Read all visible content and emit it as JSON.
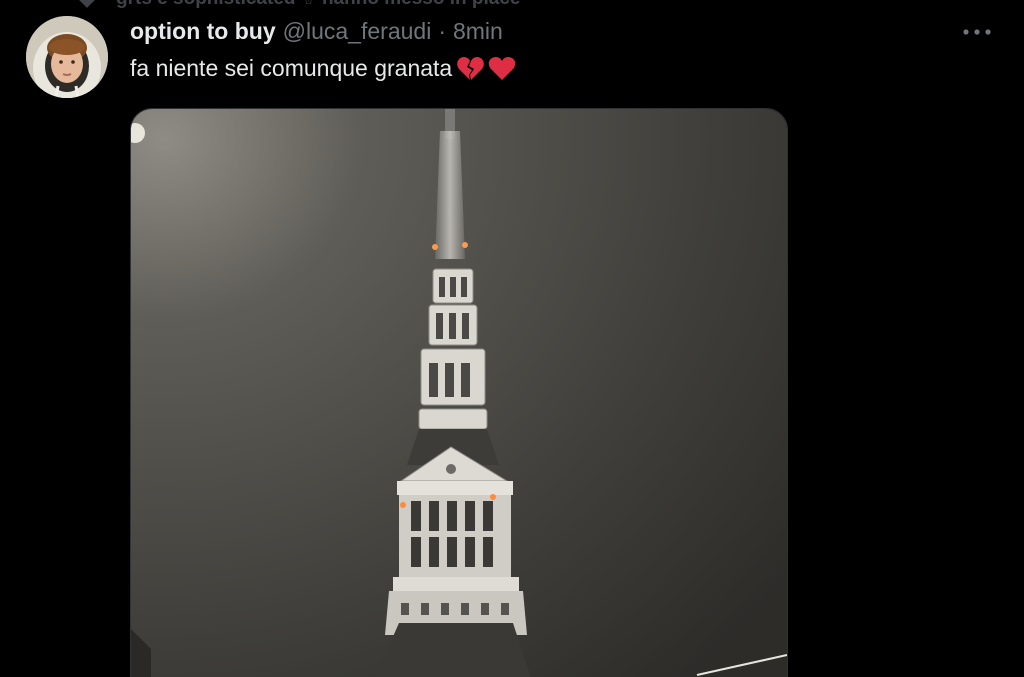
{
  "previous_tweet": {
    "partial_text": "grts e sophisticated ✌ hanno messo in place"
  },
  "author": {
    "display_name": "option to buy",
    "handle": "@luca_feraudi",
    "separator": "·",
    "timestamp": "8min"
  },
  "tweet": {
    "text": "fa niente sei comunque granata",
    "emojis": [
      "broken-heart",
      "red-heart"
    ]
  },
  "more_menu": {
    "icon": "more-horizontal-icon"
  },
  "media": {
    "kind": "photo",
    "subject_icon": "tower-spire"
  },
  "colors": {
    "background": "#000000",
    "primary_text": "#e7e9ea",
    "secondary_text": "#71767b",
    "border": "#2f3336",
    "heart": "#e0245e"
  }
}
